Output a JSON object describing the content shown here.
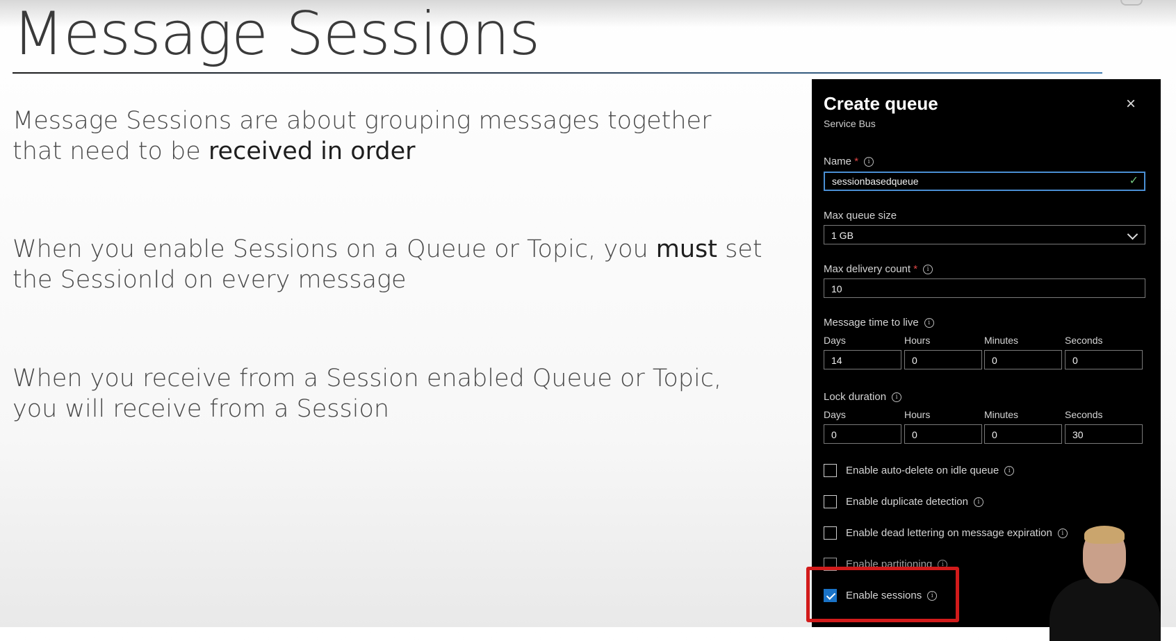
{
  "slide": {
    "title": "Message Sessions",
    "bullets": [
      {
        "before": "Message Sessions are about grouping messages together that need to be ",
        "bold": "received in order",
        "after": ""
      },
      {
        "before": "When you enable Sessions on a Queue or Topic, you ",
        "bold": "must",
        "after": " set the SessionId on every message"
      },
      {
        "before": "When you receive from a Session enabled Queue or Topic, you will receive from a Session",
        "bold": "",
        "after": ""
      }
    ]
  },
  "panel": {
    "title": "Create queue",
    "subtitle": "Service Bus",
    "close_icon": "×",
    "name": {
      "label": "Name",
      "required": "*",
      "value": "sessionbasedqueue"
    },
    "max_queue_size": {
      "label": "Max queue size",
      "value": "1 GB"
    },
    "max_delivery_count": {
      "label": "Max delivery count",
      "required": "*",
      "value": "10"
    },
    "message_ttl": {
      "label": "Message time to live",
      "fields": [
        {
          "label": "Days",
          "value": "14"
        },
        {
          "label": "Hours",
          "value": "0"
        },
        {
          "label": "Minutes",
          "value": "0"
        },
        {
          "label": "Seconds",
          "value": "0"
        }
      ]
    },
    "lock_duration": {
      "label": "Lock duration",
      "fields": [
        {
          "label": "Days",
          "value": "0"
        },
        {
          "label": "Hours",
          "value": "0"
        },
        {
          "label": "Minutes",
          "value": "0"
        },
        {
          "label": "Seconds",
          "value": "30"
        }
      ]
    },
    "checkboxes": [
      {
        "label": "Enable auto-delete on idle queue",
        "checked": false
      },
      {
        "label": "Enable duplicate detection",
        "checked": false
      },
      {
        "label": "Enable dead lettering on message expiration",
        "checked": false
      },
      {
        "label": "Enable partitioning",
        "checked": false
      },
      {
        "label": "Enable sessions",
        "checked": true
      }
    ],
    "info_glyph": "i"
  },
  "colors": {
    "accent": "#1a73c7",
    "highlight": "#d21b1b",
    "panel_bg": "#000000"
  }
}
